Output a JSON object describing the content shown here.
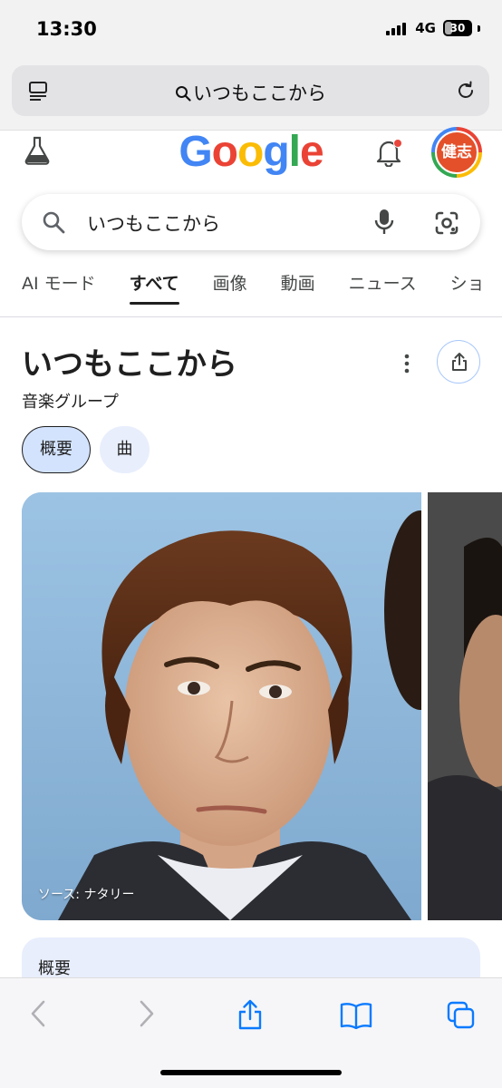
{
  "status_bar": {
    "time": "13:30",
    "network": "4G",
    "battery": "30",
    "battery_level": 0.3
  },
  "browser": {
    "address_text": "いつもここから",
    "icons": [
      "reader-icon",
      "search-icon",
      "reload-icon"
    ]
  },
  "google": {
    "logo": "Google",
    "avatar_text": "健志",
    "search_query": "いつもここから"
  },
  "tabs": [
    {
      "label": "AI モード",
      "active": false
    },
    {
      "label": "すべて",
      "active": true
    },
    {
      "label": "画像",
      "active": false
    },
    {
      "label": "動画",
      "active": false
    },
    {
      "label": "ニュース",
      "active": false
    },
    {
      "label": "ショ",
      "active": false
    }
  ],
  "knowledge_panel": {
    "title": "いつもここから",
    "subtitle": "音楽グループ",
    "chips": [
      "概要",
      "曲"
    ],
    "image_source": "ソース: ナタリー",
    "overview_heading": "概要"
  },
  "toolbar": {
    "icons": [
      "back-icon",
      "forward-icon",
      "share-icon",
      "bookmarks-icon",
      "tabs-icon"
    ]
  },
  "colors": {
    "accent_blue": "#0b57d0",
    "chip_selected_bg": "#d3e3fd",
    "google_blue": "#4285f4",
    "google_red": "#ea4335",
    "google_yellow": "#fbbc05",
    "google_green": "#34a853",
    "avatar_bg": "#e4502a"
  }
}
